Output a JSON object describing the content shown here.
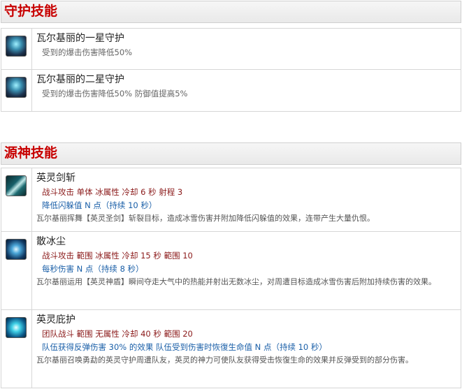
{
  "guard_section": {
    "title": "守护技能",
    "skills": [
      {
        "name": "瓦尔基丽的一星守护",
        "desc": "受到的爆击伤害降低50%"
      },
      {
        "name": "瓦尔基丽的二星守护",
        "desc": "受到的爆击伤害降低50% 防御值提高5%"
      }
    ]
  },
  "source_section": {
    "title": "源神技能",
    "skills": [
      {
        "name": "英灵剑斩",
        "stats": "战斗攻击 单体 冰属性 冷却 6 秒 射程 3",
        "effect": "降低闪躲值 N 点（持续 10 秒）",
        "lore": "瓦尔基丽挥舞【英灵圣剑】斩裂目标，造成冰雪伤害并附加降低闪躲值的效果，连带产生大量仇恨。"
      },
      {
        "name": "散冰尘",
        "stats": "战斗攻击 範围 冰属性 冷却 15 秒 範围 10",
        "effect": "每秒伤害 N 点（持续 8 秒）",
        "lore": "瓦尔基丽运用【英灵神盾】瞬间夺走大气中的热能并射出无数冰尘，对周遭目标造成冰雪伤害后附加持续伤害的效果。"
      },
      {
        "name": "英灵庇护",
        "stats": "团队战斗 範围 无属性 冷却 40 秒 範围 20",
        "effect": "队伍获得反弹伤害 30% 的效果 队伍受到伤害时恢復生命值 N 点（持续 10 秒）",
        "lore": "瓦尔基丽召唤勇勐的英灵守护周遭队友，英灵的神力可使队友获得受击恢復生命的效果并反弹受到的部分伤害。"
      }
    ]
  }
}
